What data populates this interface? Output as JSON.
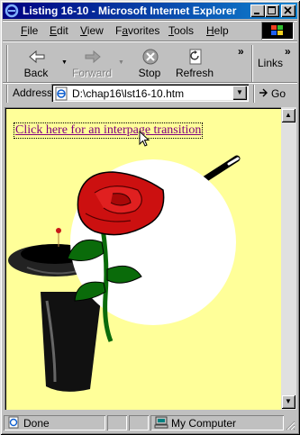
{
  "window": {
    "title": "Listing 16-10 - Microsoft Internet Explorer"
  },
  "menu": [
    {
      "label": "File",
      "u": "F",
      "rest": "ile"
    },
    {
      "label": "Edit",
      "u": "E",
      "rest": "dit"
    },
    {
      "label": "View",
      "u": "V",
      "rest": "iew"
    },
    {
      "label": "Favorites",
      "u": "a",
      "pre": "F",
      "rest": "vorites"
    },
    {
      "label": "Tools",
      "u": "T",
      "rest": "ools"
    },
    {
      "label": "Help",
      "u": "H",
      "rest": "elp"
    }
  ],
  "toolbar": {
    "back": "Back",
    "forward": "Forward",
    "stop": "Stop",
    "refresh": "Refresh",
    "links": "Links",
    "chevron": "»"
  },
  "address": {
    "label": "Address",
    "value": "D:\\chap16\\lst16-10.htm",
    "go": "Go"
  },
  "content": {
    "link_text": "Click here for an interpage transition",
    "background": "#ffff99"
  },
  "status": {
    "text": "Done",
    "zone": "My Computer"
  },
  "colors": {
    "titlebar_start": "#000080",
    "titlebar_end": "#1084d0",
    "rose_red": "#cc1010",
    "stem_green": "#0a6b0a"
  }
}
